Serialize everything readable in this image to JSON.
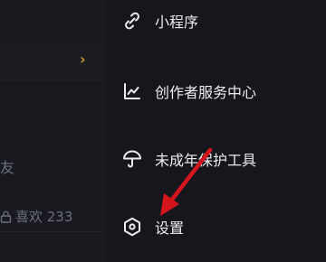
{
  "left_panel": {
    "chevron": "›",
    "friend_text": "友",
    "likes_text": "喜欢 233"
  },
  "menu": {
    "items": [
      {
        "label": "小程序",
        "icon": "mini-program-icon"
      },
      {
        "label": "创作者服务中心",
        "icon": "creator-chart-icon"
      },
      {
        "label": "未成年保护工具",
        "icon": "umbrella-icon"
      },
      {
        "label": "设置",
        "icon": "hexagon-settings-icon"
      }
    ]
  },
  "colors": {
    "background": "#16171c",
    "text": "#ececee",
    "accent_chevron": "#c9962b",
    "annotation_arrow": "#d4161c"
  }
}
